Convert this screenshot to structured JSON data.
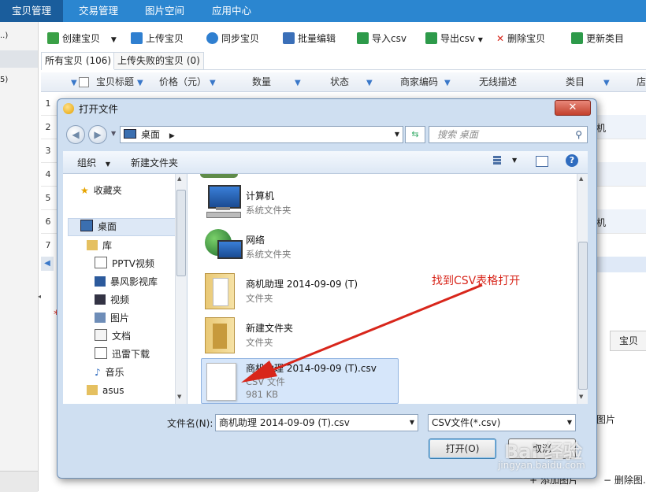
{
  "nav": {
    "tabs": [
      "宝贝管理",
      "交易管理",
      "图片空间",
      "应用中心"
    ],
    "active": 0
  },
  "left_panel": {
    "items": [
      "..)",
      "5)"
    ]
  },
  "toolbar": {
    "buttons": [
      {
        "label": "创建宝贝",
        "icon": "create-icon",
        "color": "#3aa046"
      },
      {
        "label": "上传宝贝",
        "icon": "upload-icon",
        "color": "#2f7fd0"
      },
      {
        "label": "同步宝贝",
        "icon": "sync-icon",
        "color": "#2f7fd0"
      },
      {
        "label": "批量编辑",
        "icon": "batch-edit-icon",
        "color": "#3a6fb8"
      },
      {
        "label": "导入csv",
        "icon": "import-csv-icon",
        "color": "#2d9a4a"
      },
      {
        "label": "导出csv",
        "icon": "export-csv-icon",
        "color": "#2d9a4a"
      },
      {
        "label": "删除宝贝",
        "icon": "delete-icon",
        "color": "#d8261b"
      },
      {
        "label": "更新类目",
        "icon": "update-category-icon",
        "color": "#2d9a4a"
      }
    ]
  },
  "subtabs": [
    "所有宝贝 (106)",
    "上传失败的宝贝 (0)"
  ],
  "table": {
    "columns": [
      "宝贝标题",
      "价格（元）",
      "数量",
      "状态",
      "商家编码",
      "无线描述",
      "类目",
      "店"
    ],
    "row_numbers": [
      "1",
      "2",
      "3",
      "4",
      "5",
      "6",
      "7"
    ],
    "bg_fragments": [
      "机",
      "机",
      "宝贝",
      "图片",
      "添加图片",
      "删除图."
    ]
  },
  "dialog": {
    "title": "打开文件",
    "close_label": "✕",
    "address": "桌面",
    "search_placeholder": "搜索 桌面",
    "command_bar": {
      "organize": "组织",
      "new_folder": "新建文件夹"
    },
    "nav_pane": [
      {
        "label": "收藏夹",
        "icon": "favorites-star-icon"
      },
      {
        "label": "桌面",
        "icon": "desktop-icon"
      },
      {
        "label": "库",
        "icon": "library-icon"
      },
      {
        "label": "PPTV视频",
        "icon": "pptv-video-icon"
      },
      {
        "label": "暴风影视库",
        "icon": "video-library-icon"
      },
      {
        "label": "视频",
        "icon": "video-icon"
      },
      {
        "label": "图片",
        "icon": "pictures-icon"
      },
      {
        "label": "文档",
        "icon": "documents-icon"
      },
      {
        "label": "迅雷下载",
        "icon": "thunder-download-icon"
      },
      {
        "label": "音乐",
        "icon": "music-icon"
      },
      {
        "label": "asus",
        "icon": "user-folder-icon"
      }
    ],
    "files": [
      {
        "name": "计算机",
        "type": "系统文件夹",
        "icon": "computer-icon"
      },
      {
        "name": "网络",
        "type": "系统文件夹",
        "icon": "network-icon"
      },
      {
        "name": "商机助理 2014-09-09 (T)",
        "type": "文件夹",
        "icon": "folder-icon"
      },
      {
        "name": "新建文件夹",
        "type": "文件夹",
        "icon": "folder-icon"
      },
      {
        "name": "商机助理 2014-09-09 (T).csv",
        "type": "CSV 文件",
        "size": "981 KB",
        "icon": "csv-file-icon"
      }
    ],
    "filename_label": "文件名(N):",
    "filename_value": "商机助理 2014-09-09 (T).csv",
    "filetype_value": "CSV文件(*.csv)",
    "open_label": "打开(O)",
    "cancel_label": "取消"
  },
  "annotation": {
    "text": "找到CSV表格打开",
    "color": "#d8261b"
  },
  "watermark": {
    "main": "Bai 经验",
    "url": "jingyan.baidu.com"
  }
}
